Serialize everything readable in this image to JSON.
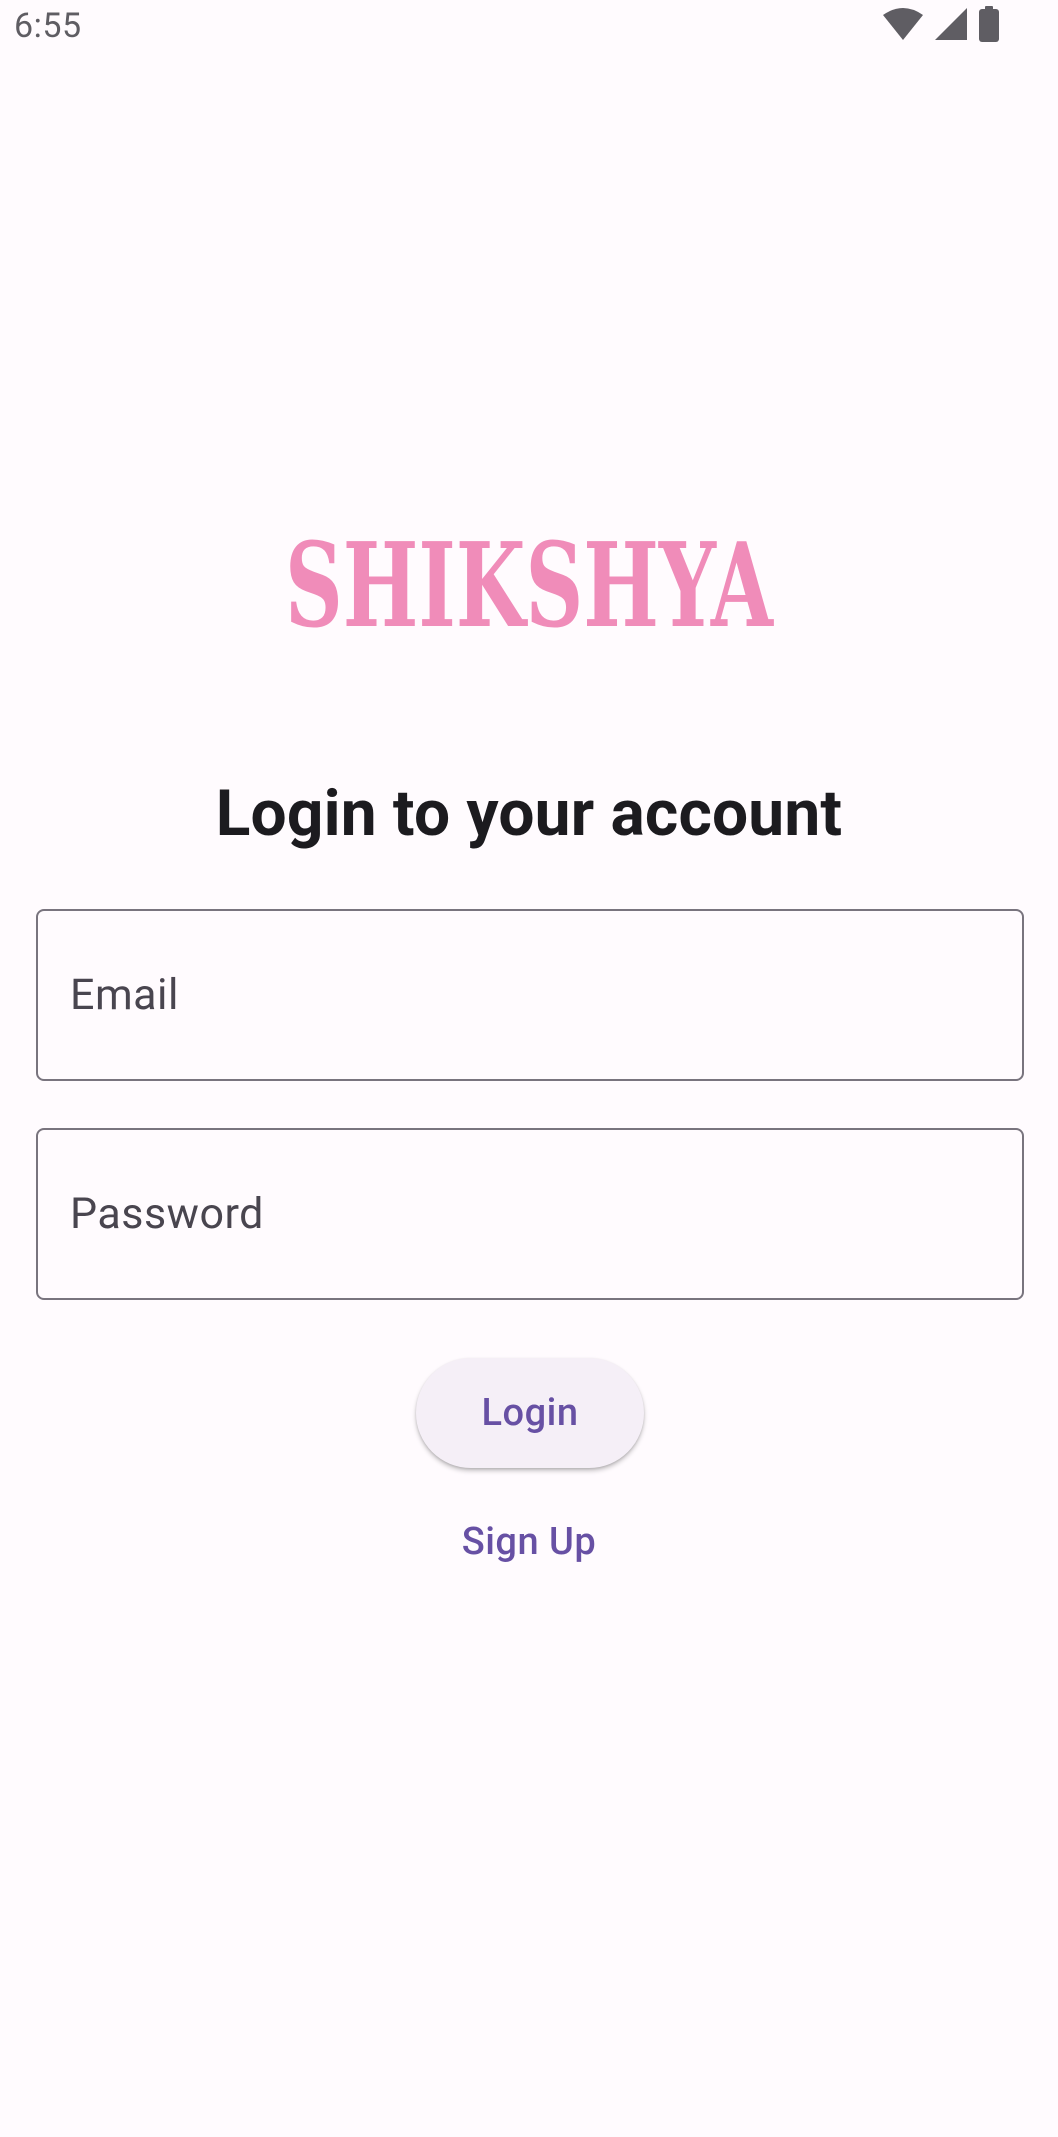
{
  "status_bar": {
    "time": "6:55",
    "icons": [
      "wifi-icon",
      "cellular-signal-icon",
      "battery-icon"
    ]
  },
  "logo": {
    "text": "SHIKSHYA",
    "color": "#f08cb9"
  },
  "login": {
    "heading": "Login to your account",
    "email_placeholder": "Email",
    "email_value": "",
    "password_placeholder": "Password",
    "password_value": "",
    "login_button_label": "Login",
    "signup_link_label": "Sign Up"
  },
  "colors": {
    "background": "#fffbfe",
    "primary": "#6750a4",
    "outline": "#79747e",
    "button_surface": "#f5eff7"
  }
}
